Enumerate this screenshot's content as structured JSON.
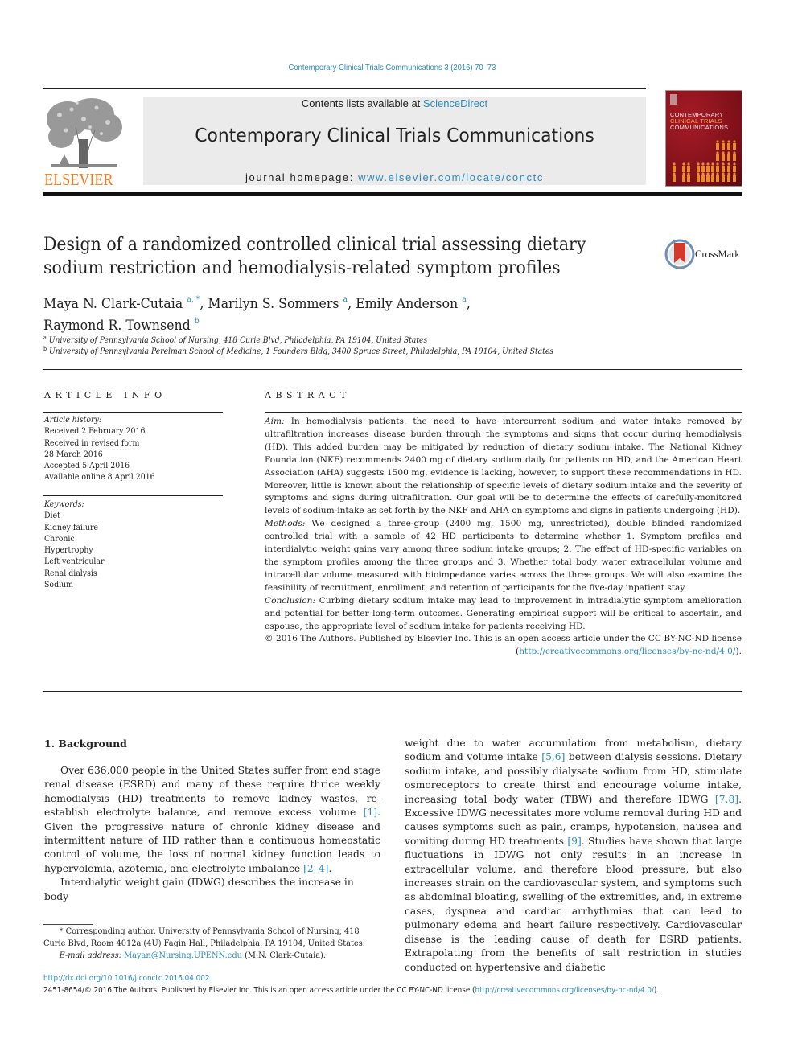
{
  "header": {
    "citation": "Contemporary Clinical Trials Communications 3 (2016) 70–73",
    "publisher_logo_text": "ELSEVIER",
    "contents_prefix": "Contents lists available at ",
    "contents_link": "ScienceDirect",
    "journal_title": "Contemporary Clinical Trials Communications",
    "homepage_prefix": "journal homepage: ",
    "homepage_link": "www.elsevier.com/locate/conctc",
    "cover": {
      "line1": "CONTEMPORARY",
      "line2": "CLINICAL TRIALS",
      "line3": "COMMUNICATIONS"
    }
  },
  "article": {
    "title": "Design of a randomized controlled clinical trial assessing dietary sodium restriction and hemodialysis-related symptom profiles",
    "crossmark_label": "CrossMark",
    "authors": [
      {
        "name": "Maya N. Clark-Cutaia",
        "sup": "a, *",
        "sep": ", "
      },
      {
        "name": "Marilyn S. Sommers",
        "sup": "a",
        "sep": ", "
      },
      {
        "name": "Emily Anderson",
        "sup": "a",
        "sep": ","
      },
      {
        "name": "Raymond R. Townsend",
        "sup": "b",
        "sep": ""
      }
    ],
    "affiliations": [
      {
        "mark": "a",
        "text": "University of Pennsylvania School of Nursing, 418 Curie Blvd, Philadelphia, PA 19104, United States"
      },
      {
        "mark": "b",
        "text": "University of Pennsylvania Perelman School of Medicine, 1 Founders Bldg, 3400 Spruce Street, Philadelphia, PA 19104, United States"
      }
    ]
  },
  "article_info": {
    "heading": "ARTICLE INFO",
    "history_label": "Article history:",
    "history": [
      "Received 2 February 2016",
      "Received in revised form",
      "28 March 2016",
      "Accepted 5 April 2016",
      "Available online 8 April 2016"
    ],
    "keywords_label": "Keywords:",
    "keywords": [
      "Diet",
      "Kidney failure",
      "Chronic",
      "Hypertrophy",
      "Left ventricular",
      "Renal dialysis",
      "Sodium"
    ]
  },
  "abstract": {
    "heading": "ABSTRACT",
    "aim_label": "Aim:",
    "aim": "In hemodialysis patients, the need to have intercurrent sodium and water intake removed by ultrafiltration increases disease burden through the symptoms and signs that occur during hemodialysis (HD). This added burden may be mitigated by reduction of dietary sodium intake. The National Kidney Foundation (NKF) recommends 2400 mg of dietary sodium daily for patients on HD, and the American Heart Association (AHA) suggests 1500 mg, evidence is lacking, however, to support these recommendations in HD. Moreover, little is known about the relationship of specific levels of dietary sodium intake and the severity of symptoms and signs during ultrafiltration. Our goal will be to determine the effects of carefully-monitored levels of sodium-intake as set forth by the NKF and AHA on symptoms and signs in patients undergoing (HD).",
    "methods_label": "Methods:",
    "methods": "We designed a three-group (2400 mg, 1500 mg, unrestricted), double blinded randomized controlled trial with a sample of 42 HD participants to determine whether 1. Symptom profiles and interdialytic weight gains vary among three sodium intake groups; 2. The effect of HD-specific variables on the symptom profiles among the three groups and 3. Whether total body water extracellular volume and intracellular volume measured with bioimpedance varies across the three groups. We will also examine the feasibility of recruitment, enrollment, and retention of participants for the five-day inpatient stay.",
    "conclusion_label": "Conclusion:",
    "conclusion": "Curbing dietary sodium intake may lead to improvement in intradialytic symptom amelioration and potential for better long-term outcomes. Generating empirical support will be critical to ascertain, and espouse, the appropriate level of sodium intake for patients receiving HD.",
    "license_text": "© 2016 The Authors. Published by Elsevier Inc. This is an open access article under the CC BY-NC-ND license (",
    "license_link": "http://creativecommons.org/licenses/by-nc-nd/4.0/",
    "license_end": ")."
  },
  "body": {
    "section_title": "1.  Background",
    "p1_a": "Over 636,000 people in the United States suffer from end stage renal disease (ESRD) and many of these require thrice weekly hemodialysis (HD) treatments to remove kidney wastes, re-establish electrolyte balance, and remove excess volume ",
    "p1_ref1": "[1]",
    "p1_b": ". Given the progressive nature of chronic kidney disease and intermittent nature of HD rather than a continuous homeostatic control of volume, the loss of normal kidney function leads to hypervolemia, azotemia, and electrolyte imbalance ",
    "p1_ref2": "[2–4]",
    "p1_c": ".",
    "p2_a": "Interdialytic weight gain (IDWG) describes the increase in body weight due to water accumulation from metabolism, dietary sodium and volume intake ",
    "p2_ref1": "[5,6]",
    "p2_b": " between dialysis sessions. Dietary sodium intake, and possibly dialysate sodium from HD, stimulate osmoreceptors to create thirst and encourage volume intake, increasing total body water (TBW) and therefore IDWG ",
    "p2_ref2": "[7,8]",
    "p2_c": ". Excessive IDWG necessitates more volume removal during HD and causes symptoms such as pain, cramps, hypotension, nausea and vomiting during HD treatments ",
    "p2_ref3": "[9]",
    "p2_d": ". Studies have shown that large fluctuations in IDWG not only results in an increase in extracellular volume, and therefore blood pressure, but also increases strain on the cardiovascular system, and symptoms such as abdominal bloating, swelling of the extremities, and, in extreme cases, dyspnea and cardiac arrhythmias that can lead to pulmonary edema and heart failure respectively. Cardiovascular disease is the leading cause of death for ESRD patients. Extrapolating from the benefits of salt restriction in studies conducted on hypertensive and diabetic",
    "p2_left_part": "Interdialytic weight gain (IDWG) describes the increase in body",
    "p2_right_start": "weight due to water accumulation from metabolism, dietary sodium and volume intake "
  },
  "footnote": {
    "corresponding": "* Corresponding author. University of Pennsylvania School of Nursing, 418 Curie Blvd, Room 4012a (4U) Fagin Hall, Philadelphia, PA 19104, United States.",
    "email_label": "E-mail address:",
    "email": "Mayan@Nursing.UPENN.edu",
    "email_suffix": " (M.N. Clark-Cutaia)."
  },
  "footer": {
    "doi": "http://dx.doi.org/10.1016/j.conctc.2016.04.002",
    "issn_text": "2451-8654/© 2016 The Authors. Published by Elsevier Inc. This is an open access article under the CC BY-NC-ND license (",
    "issn_link": "http://creativecommons.org/licenses/by-nc-nd/4.0/",
    "issn_end": ")."
  },
  "colors": {
    "link": "#2a8bbd",
    "elsevier_orange": "#f07b1d",
    "cover_red": "#8c141d",
    "banner_gray": "#ebebeb"
  }
}
